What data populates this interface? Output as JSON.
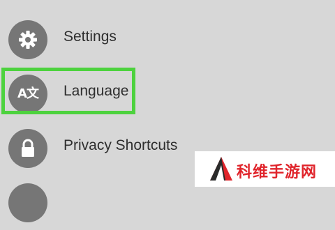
{
  "menu": {
    "items": [
      {
        "label": "Settings",
        "icon": "gear-icon"
      },
      {
        "label": "Language",
        "icon": "language-icon",
        "icon_text": "A文"
      },
      {
        "label": "Privacy Shortcuts",
        "icon": "lock-icon"
      },
      {
        "label": "",
        "icon": "unknown-icon"
      }
    ]
  },
  "highlight": {
    "target": "Language",
    "color": "#4dd23e"
  },
  "watermark": {
    "text": "科维手游网"
  },
  "colors": {
    "background": "#d7d7d7",
    "icon_circle": "#767676",
    "label_text": "#2e2e2e",
    "watermark_red": "#e0242b"
  }
}
